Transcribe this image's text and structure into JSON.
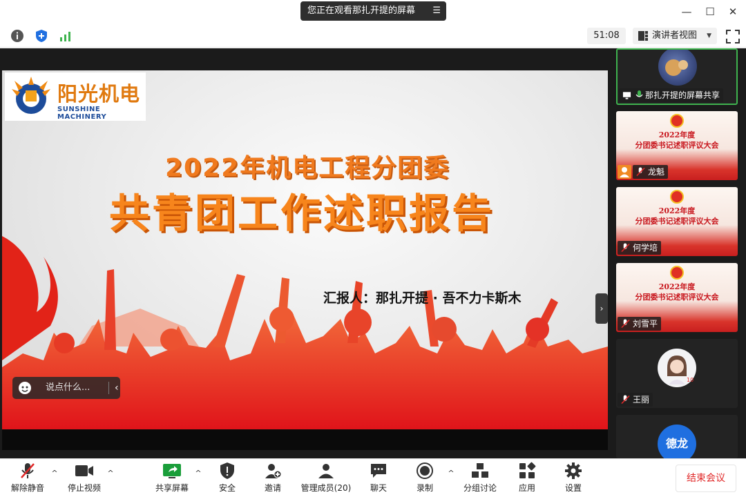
{
  "titlebar": {
    "viewing_text": "您正在观看那扎开提的屏幕",
    "menu_icon": "list-menu-icon",
    "window_controls": [
      "minimize-icon",
      "maximize-icon",
      "close-icon"
    ]
  },
  "toolbar": {
    "icons": [
      "info-icon",
      "shield-icon",
      "signal-icon"
    ],
    "timer": "51:08",
    "speaker_view_label": "演讲者视图",
    "fullscreen_icon": "fullscreen-icon"
  },
  "slide": {
    "logo_cn": "阳光机电",
    "logo_en": "SUNSHINE MACHINERY",
    "title_line1": "2022年机电工程分团委",
    "title_line2": "共青团工作述职报告",
    "reporter": "汇报人：那扎开提 · 吾不力卡斯木"
  },
  "chat": {
    "placeholder": "说点什么...",
    "chevron": "‹"
  },
  "participants": {
    "sharer_label": "那扎开提的屏幕共享",
    "mini_slide_title1": "2022年度",
    "mini_slide_title2": "分团委书记述职评议大会",
    "tiles": [
      {
        "name": "龙魁",
        "muted": true
      },
      {
        "name": "何学培",
        "muted": true
      },
      {
        "name": "刘雪平",
        "muted": true
      },
      {
        "name": "王丽",
        "muted": true
      }
    ],
    "partial_avatar_text": "德龙"
  },
  "controls": {
    "unmute": "解除静音",
    "stop_video": "停止视频",
    "share_screen": "共享屏幕",
    "security": "安全",
    "invite": "邀请",
    "participants": "管理成员(20)",
    "chat": "聊天",
    "record": "录制",
    "breakout": "分组讨论",
    "apps": "应用",
    "settings": "设置",
    "end_meeting": "结束会议"
  },
  "colors": {
    "accent_green": "#3fb34f",
    "slide_orange": "#f7851c",
    "end_red": "#e02828",
    "panel_dark": "#1b1b1b"
  }
}
